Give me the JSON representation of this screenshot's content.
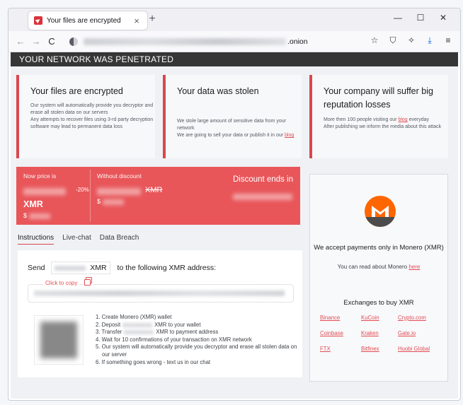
{
  "browser": {
    "tab_title": "Your files are encrypted",
    "tab_close": "×",
    "new_tab": "+",
    "url_suffix": ".onion",
    "win": {
      "minimize": "—",
      "maximize": "☐",
      "close": "✕"
    },
    "nav": {
      "back": "←",
      "forward": "→",
      "reload": "C"
    },
    "toolbar": {
      "bookmark": "☆",
      "shield": "⛉",
      "extensions": "✧",
      "download": "⤓",
      "menu": "≡"
    }
  },
  "page": {
    "banner": "YOUR NETWORK WAS PENETRATED",
    "cards": [
      {
        "title": "Your files are encrypted",
        "body": "Our system will automatically provide you decryptor and erase all stolen data on our servers\nAny attempts to recover files using 3-rd party decryption software may lead to permanent data loss"
      },
      {
        "title": "Your data was stolen",
        "body_pre": "We stole large amount of sensitive data from your network\nWe are going to sell your data or publish it in our ",
        "link": "blog"
      },
      {
        "title": "Your company will suffer big reputation losses",
        "body_pre": "More then 100 people visiting our ",
        "link": "blog",
        "body_post": " everyday\nAfter publishing we inform the media about this attack"
      }
    ],
    "price": {
      "now_label": "Now price is",
      "discount": "-20%",
      "currency": "XMR",
      "usd": "$",
      "without_label": "Without discount",
      "strike_currency": "XMR",
      "usd2": "$",
      "ends_label": "Discount ends in"
    },
    "tabs": [
      "Instructions",
      "Live-chat",
      "Data Breach"
    ],
    "instructions": {
      "send": "Send",
      "currency": "XMR",
      "to_address": "to the following XMR address:",
      "copy": "Click to copy",
      "steps": {
        "s1": "1. Create Monero (XMR) wallet",
        "s2a": "2. Deposit",
        "s2b": "XMR to your wallet",
        "s3a": "3. Transfer",
        "s3b": "XMR to payment address",
        "s4": "4. Wait for 10 confirmations of your transaction on XMR network",
        "s5": "5. Our system will automatically provide you decryptor and erase all stolen data on our server",
        "s6": "6. If something goes wrong - text us in our chat"
      }
    },
    "payment": {
      "accept": "We accept payments only in Monero (XMR)",
      "read_pre": "You can read about Monero ",
      "read_link": "here",
      "exchanges_title": "Exchanges to buy XMR",
      "exchanges": [
        "Binance",
        "KuCoin",
        "Crypto.com",
        "Coinbase",
        "Kraken",
        "Gate.io",
        "FTX",
        "Bitfinex",
        "Huobi Global"
      ]
    }
  },
  "colors": {
    "accent": "#e8565a",
    "banner": "#363636",
    "monero_orange": "#ff6600"
  }
}
